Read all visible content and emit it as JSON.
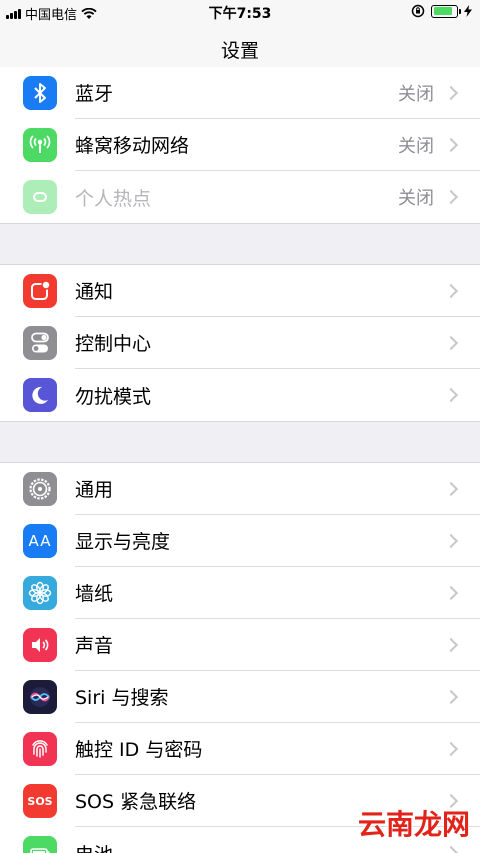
{
  "status_bar": {
    "carrier": "中国电信",
    "time": "下午7:53",
    "battery_level": 0.85
  },
  "nav": {
    "title": "设置"
  },
  "groups": [
    {
      "rows": [
        {
          "label": "蓝牙",
          "value": "关闭",
          "icon": "bluetooth-icon",
          "color": "#1a7cf5"
        },
        {
          "label": "蜂窝移动网络",
          "value": "关闭",
          "icon": "cellular-icon",
          "color": "#4cd964"
        },
        {
          "label": "个人热点",
          "value": "关闭",
          "icon": "hotspot-icon",
          "color": "#4cd964",
          "disabled": true
        }
      ]
    },
    {
      "rows": [
        {
          "label": "通知",
          "icon": "notifications-icon",
          "color": "#f23a30"
        },
        {
          "label": "控制中心",
          "icon": "control-center-icon",
          "color": "#8e8e93"
        },
        {
          "label": "勿扰模式",
          "icon": "moon-icon",
          "color": "#5856d6"
        }
      ]
    },
    {
      "rows": [
        {
          "label": "通用",
          "icon": "gear-icon",
          "color": "#8e8e93"
        },
        {
          "label": "显示与亮度",
          "icon": "display-icon",
          "color": "#1a7cf5"
        },
        {
          "label": "墙纸",
          "icon": "wallpaper-icon",
          "color": "#36aadc"
        },
        {
          "label": "声音",
          "icon": "sound-icon",
          "color": "#f23454"
        },
        {
          "label": "Siri 与搜索",
          "icon": "siri-icon",
          "color": "#1c1c3a"
        },
        {
          "label": "触控 ID 与密码",
          "icon": "fingerprint-icon",
          "color": "#f23454"
        },
        {
          "label": "SOS 紧急联络",
          "icon": "sos-icon",
          "color": "#f23a30"
        },
        {
          "label": "电池",
          "icon": "battery-icon",
          "color": "#4cd964"
        }
      ]
    }
  ],
  "icon_text": {
    "display": "AA",
    "sos": "SOS"
  },
  "watermark": "云南龙网"
}
